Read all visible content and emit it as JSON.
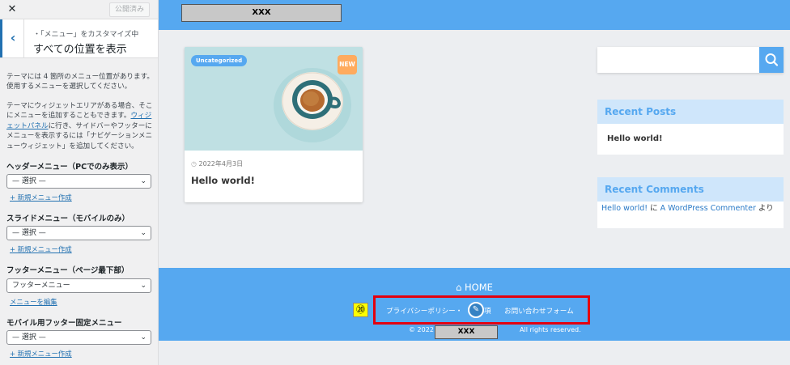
{
  "customizer": {
    "close_icon": "close-icon",
    "publish_label": "公開済み",
    "back_icon": "chevron-left-icon",
    "breadcrumb": "・「メニュー」をカスタマイズ中",
    "title": "すべての位置を表示",
    "desc1": "テーマには 4 箇所のメニュー位置があります。使用するメニューを選択してください。",
    "desc2_pre": "テーマにウィジェットエリアがある場合、そこにメニューを追加することもできます。",
    "desc2_link": "ウィジェットパネル",
    "desc2_post": "に行き、サイドバーやフッターにメニューを表示するには「ナビゲーションメニューウィジェット」を追加してください。",
    "locations": [
      {
        "label": "ヘッダーメニュー（PCでのみ表示）",
        "value": "— 選択 —",
        "action": "+ 新規メニュー作成"
      },
      {
        "label": "スライドメニュー（モバイルのみ）",
        "value": "— 選択 —",
        "action": "+ 新規メニュー作成"
      },
      {
        "label": "フッターメニュー（ページ最下部）",
        "value": "フッターメニュー",
        "action": "メニューを編集"
      },
      {
        "label": "モバイル用フッター固定メニュー",
        "value": "— 選択 —",
        "action": "+ 新規メニュー作成"
      }
    ]
  },
  "site": {
    "header_box": "XXX",
    "post": {
      "category": "Uncategorized",
      "new_badge": "NEW",
      "date": "2022年4月3日",
      "title": "Hello world!"
    },
    "search_icon": "search-icon",
    "recent_posts": {
      "title": "Recent Posts",
      "item": "Hello world!"
    },
    "recent_comments": {
      "title": "Recent Comments",
      "post_link": "Hello world!",
      "connector": " に ",
      "author_link": "A WordPress Commenter",
      "suffix": " より"
    },
    "footer": {
      "home": "HOME",
      "nav_item1": "プライバシーポリシー・",
      "nav_item1_rest": "事項",
      "nav_item2": "お問い合わせフォーム",
      "badge": "⑳",
      "copy_pre": "© 2022",
      "copy_post": "All rights reserved.",
      "box": "XXX"
    }
  },
  "colors": {
    "accent": "#56a8f0",
    "highlight_frame": "#e3000f",
    "wp_blue": "#2271b1"
  }
}
